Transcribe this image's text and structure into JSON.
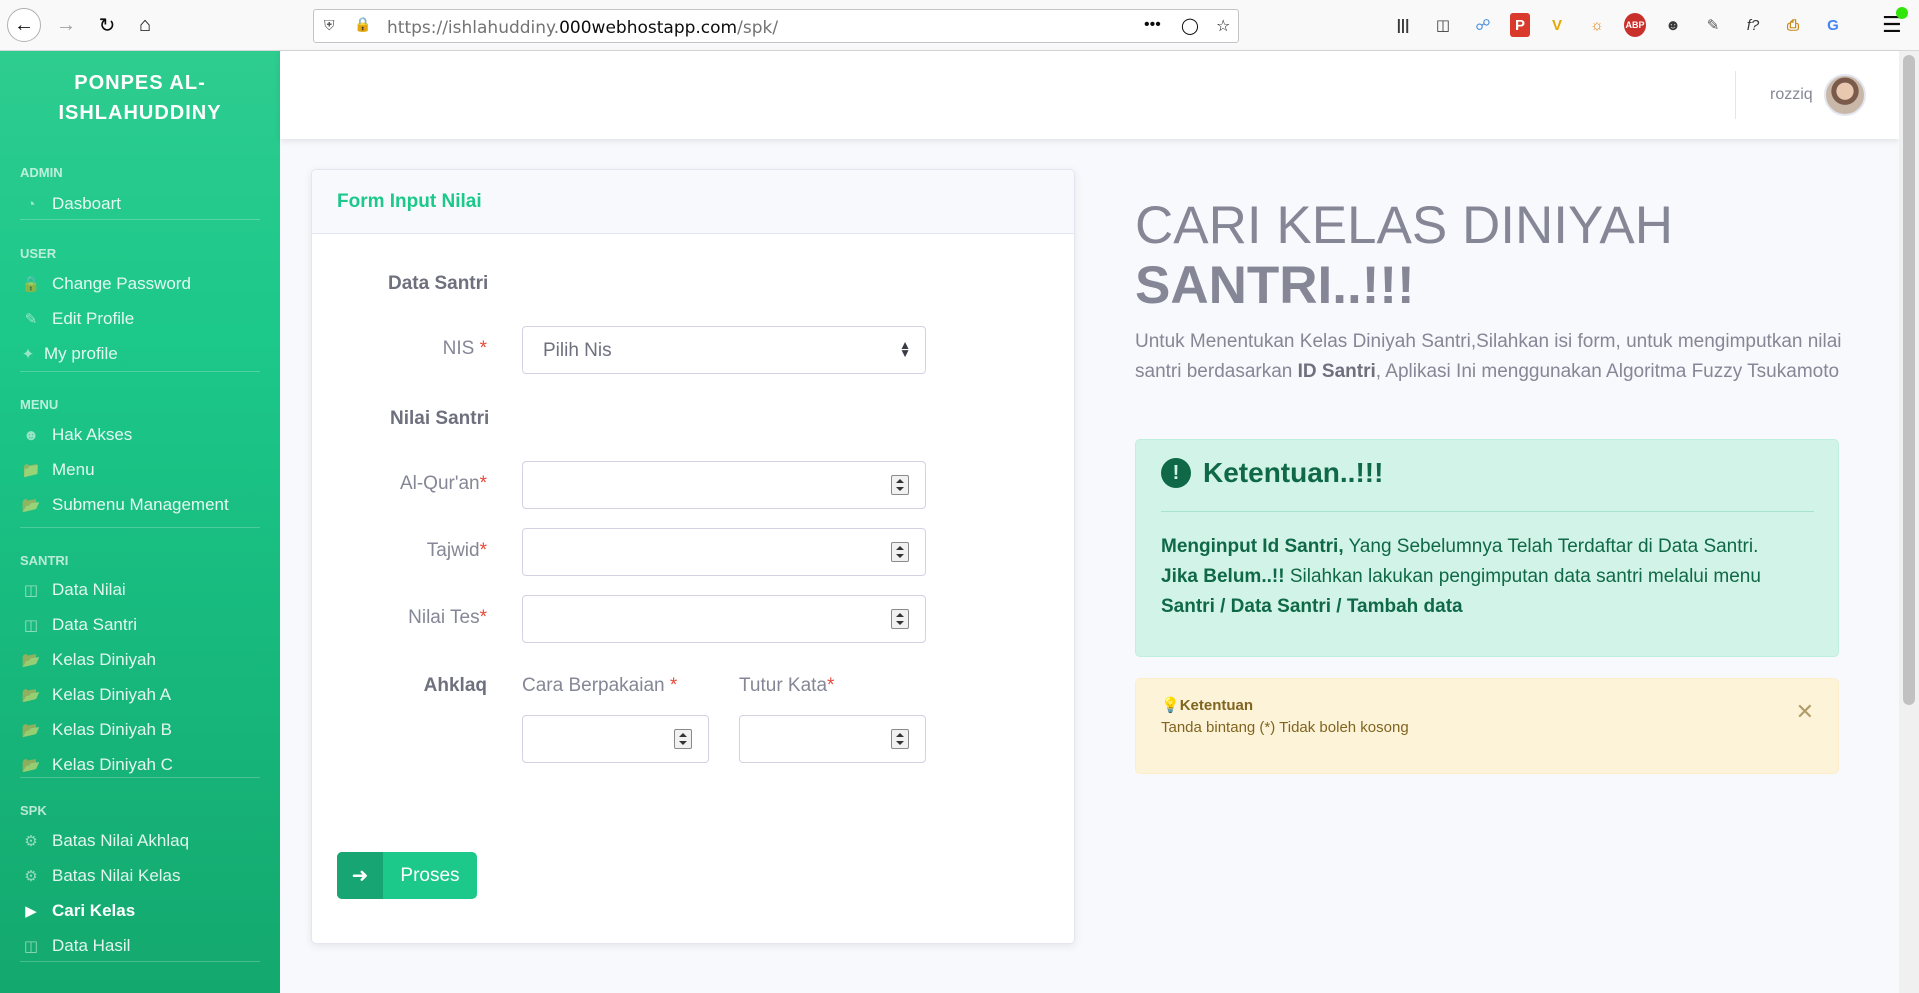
{
  "browser": {
    "url_prefix": "https://ishlahuddiny.",
    "url_domain": "000webhostapp.com",
    "url_path": "/spk/"
  },
  "sidebar": {
    "brand_line1": "PONPES AL-",
    "brand_line2": "ISHLAHUDDINY",
    "sections": {
      "admin": "ADMIN",
      "user": "USER",
      "menu": "MENU",
      "santri": "SANTRI",
      "spk": "SPK"
    },
    "items": {
      "dasboart": "Dasboart",
      "change_password": "Change Password",
      "edit_profile": "Edit Profile",
      "my_profile": "My profile",
      "hak_akses": "Hak Akses",
      "menu": "Menu",
      "submenu": "Submenu Management",
      "data_nilai": "Data Nilai",
      "data_santri": "Data Santri",
      "kelas_diniyah": "Kelas Diniyah",
      "kelas_a": "Kelas Diniyah A",
      "kelas_b": "Kelas Diniyah B",
      "kelas_c": "Kelas Diniyah C",
      "batas_akhlaq": "Batas Nilai Akhlaq",
      "batas_kelas": "Batas Nilai Kelas",
      "cari_kelas": "Cari Kelas",
      "data_hasil": "Data Hasil"
    }
  },
  "topbar": {
    "username": "rozziq"
  },
  "form": {
    "title": "Form Input Nilai",
    "section_data_santri": "Data Santri",
    "nis_label": "NIS",
    "nis_select": "Pilih Nis",
    "section_nilai_santri": "Nilai Santri",
    "alquran_label": "Al-Qur'an",
    "tajwid_label": "Tajwid",
    "nilai_tes_label": "Nilai Tes",
    "akhlaq_label": "Ahklaq",
    "cara_berpakaian_label": "Cara Berpakaian",
    "tutur_kata_label": "Tutur Kata",
    "required_mark": "*",
    "submit_label": "Proses"
  },
  "main": {
    "headline_line1": "CARI KELAS DINIYAH",
    "headline_line2": "SANTRI..!!!",
    "lead_part1": "Untuk Menentukan Kelas Diniyah Santri,Silahkan isi form, untuk mengimputkan nilai santri berdasarkan ",
    "lead_bold": "ID Santri",
    "lead_part2": ", Aplikasi Ini menggunakan Algoritma Fuzzy Tsukamoto",
    "alert_title": "Ketentuan..!!!",
    "alert_bold1": "Menginput Id Santri,",
    "alert_text1": " Yang Sebelumnya Telah Terdaftar di Data Santri.",
    "alert_bold2": "Jika Belum..!!",
    "alert_text2": " Silahkan lakukan pengimputan data santri melalui menu ",
    "alert_bold3": "Santri / Data Santri / Tambah data",
    "warning_title": "Ketentuan",
    "warning_text": "Tanda bintang (*) Tidak boleh kosong"
  },
  "colors": {
    "primary": "#1cc88a",
    "danger": "#e74a3b",
    "text_muted": "#858796"
  }
}
